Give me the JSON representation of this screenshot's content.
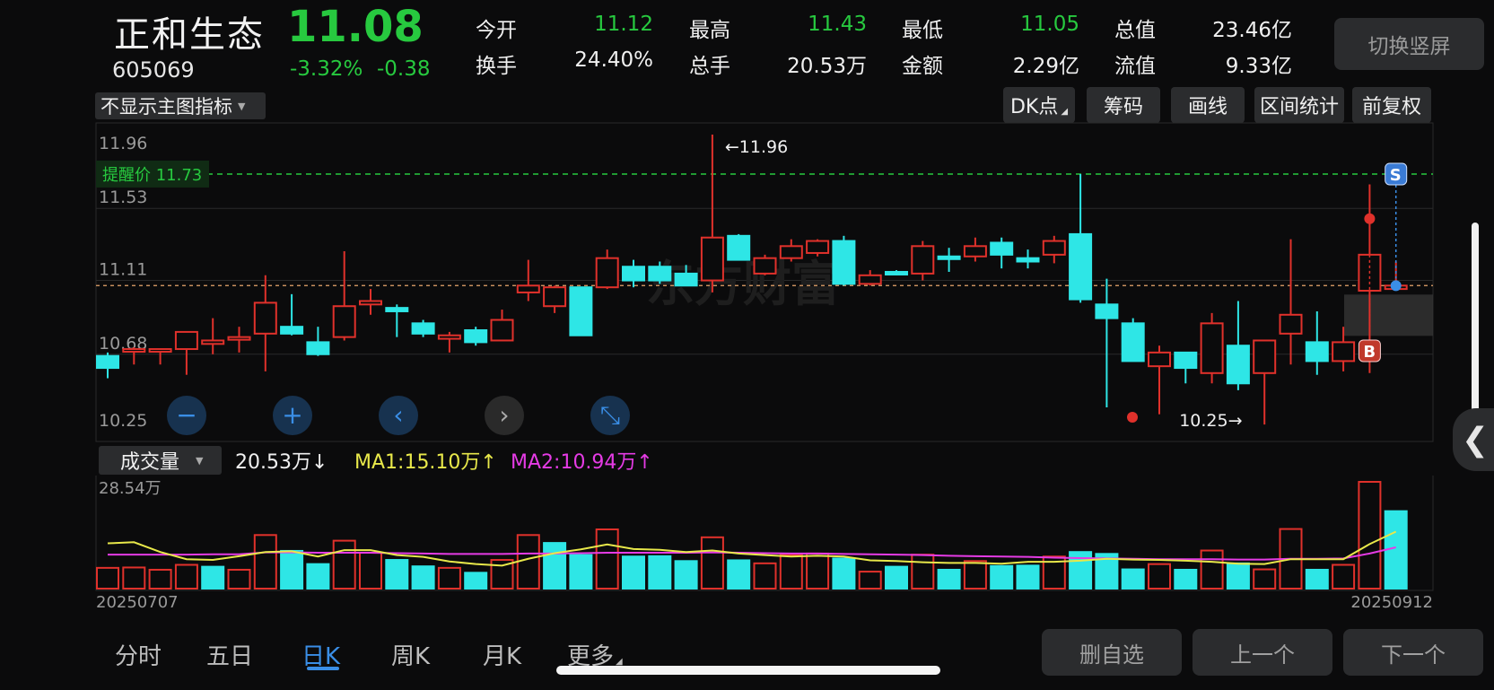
{
  "stock": {
    "name": "正和生态",
    "code": "605069",
    "price": "11.08",
    "pct": "-3.32%",
    "change": "-0.38"
  },
  "stats": [
    {
      "label": "今开",
      "value": "11.12",
      "color": "#27c93f"
    },
    {
      "label": "换手",
      "value": "24.40%",
      "color": "#f0f0f0"
    },
    {
      "label": "最高",
      "value": "11.43",
      "color": "#27c93f"
    },
    {
      "label": "总手",
      "value": "20.53万",
      "color": "#f0f0f0"
    },
    {
      "label": "最低",
      "value": "11.05",
      "color": "#27c93f"
    },
    {
      "label": "金额",
      "value": "2.29亿",
      "color": "#f0f0f0"
    },
    {
      "label": "总值",
      "value": "23.46亿",
      "color": "#f0f0f0"
    },
    {
      "label": "流值",
      "value": "9.33亿",
      "color": "#f0f0f0"
    }
  ],
  "switch_label": "切换竖屏",
  "indicator_select": "不显示主图指标",
  "toolbar": [
    "DK点",
    "筹码",
    "画线",
    "区间统计",
    "前复权"
  ],
  "chart": {
    "y_labels": [
      "11.96",
      "11.53",
      "11.11",
      "10.68",
      "10.25"
    ],
    "alert": "提醒价 11.73",
    "alert_price": 11.73,
    "reference_price": 11.08,
    "high_marker": "←11.96",
    "low_marker": "10.25→",
    "buy_marker": "B",
    "sell_marker": "S",
    "watermark": "东方财富",
    "up_color": "#e0312b",
    "down_color": "#2ee6e6",
    "alert_color": "#27c93f"
  },
  "chart_data": {
    "type": "candlestick",
    "ylim": [
      10.25,
      11.96
    ],
    "candles": [
      {
        "o": 10.67,
        "h": 10.69,
        "l": 10.54,
        "c": 10.6
      },
      {
        "o": 10.7,
        "h": 10.72,
        "l": 10.62,
        "c": 10.71
      },
      {
        "o": 10.71,
        "h": 10.71,
        "l": 10.62,
        "c": 10.71
      },
      {
        "o": 10.71,
        "h": 10.81,
        "l": 10.56,
        "c": 10.81
      },
      {
        "o": 10.74,
        "h": 10.89,
        "l": 10.68,
        "c": 10.76
      },
      {
        "o": 10.77,
        "h": 10.84,
        "l": 10.69,
        "c": 10.78
      },
      {
        "o": 10.8,
        "h": 11.14,
        "l": 10.58,
        "c": 10.98
      },
      {
        "o": 10.84,
        "h": 11.03,
        "l": 10.79,
        "c": 10.8
      },
      {
        "o": 10.75,
        "h": 10.84,
        "l": 10.67,
        "c": 10.68
      },
      {
        "o": 10.78,
        "h": 11.28,
        "l": 10.76,
        "c": 10.96
      },
      {
        "o": 10.97,
        "h": 11.06,
        "l": 10.91,
        "c": 10.99
      },
      {
        "o": 10.95,
        "h": 10.97,
        "l": 10.78,
        "c": 10.93
      },
      {
        "o": 10.86,
        "h": 10.88,
        "l": 10.78,
        "c": 10.8
      },
      {
        "o": 10.77,
        "h": 10.81,
        "l": 10.69,
        "c": 10.79
      },
      {
        "o": 10.82,
        "h": 10.84,
        "l": 10.73,
        "c": 10.75
      },
      {
        "o": 10.76,
        "h": 10.94,
        "l": 10.76,
        "c": 10.88
      },
      {
        "o": 11.04,
        "h": 11.23,
        "l": 10.99,
        "c": 11.08
      },
      {
        "o": 10.96,
        "h": 11.08,
        "l": 10.92,
        "c": 11.07
      },
      {
        "o": 11.07,
        "h": 11.07,
        "l": 10.79,
        "c": 10.79
      },
      {
        "o": 11.07,
        "h": 11.29,
        "l": 11.06,
        "c": 11.24
      },
      {
        "o": 11.19,
        "h": 11.23,
        "l": 11.07,
        "c": 11.11
      },
      {
        "o": 11.19,
        "h": 11.22,
        "l": 11.09,
        "c": 11.11
      },
      {
        "o": 11.15,
        "h": 11.2,
        "l": 11.08,
        "c": 11.08
      },
      {
        "o": 11.11,
        "h": 11.96,
        "l": 11.04,
        "c": 11.36
      },
      {
        "o": 11.37,
        "h": 11.38,
        "l": 11.24,
        "c": 11.23
      },
      {
        "o": 11.15,
        "h": 11.26,
        "l": 11.14,
        "c": 11.24
      },
      {
        "o": 11.24,
        "h": 11.35,
        "l": 11.22,
        "c": 11.31
      },
      {
        "o": 11.27,
        "h": 11.35,
        "l": 11.25,
        "c": 11.34
      },
      {
        "o": 11.34,
        "h": 11.37,
        "l": 11.08,
        "c": 11.09
      },
      {
        "o": 11.09,
        "h": 11.17,
        "l": 11.08,
        "c": 11.14
      },
      {
        "o": 11.16,
        "h": 11.17,
        "l": 11.14,
        "c": 11.15
      },
      {
        "o": 11.15,
        "h": 11.34,
        "l": 11.11,
        "c": 11.31
      },
      {
        "o": 11.25,
        "h": 11.3,
        "l": 11.16,
        "c": 11.24
      },
      {
        "o": 11.25,
        "h": 11.36,
        "l": 11.22,
        "c": 11.31
      },
      {
        "o": 11.33,
        "h": 11.36,
        "l": 11.18,
        "c": 11.26
      },
      {
        "o": 11.24,
        "h": 11.29,
        "l": 11.18,
        "c": 11.22
      },
      {
        "o": 11.26,
        "h": 11.37,
        "l": 11.21,
        "c": 11.34
      },
      {
        "o": 11.38,
        "h": 11.73,
        "l": 10.98,
        "c": 11.0
      },
      {
        "o": 10.97,
        "h": 11.12,
        "l": 10.37,
        "c": 10.89
      },
      {
        "o": 10.86,
        "h": 10.89,
        "l": 10.64,
        "c": 10.64
      },
      {
        "o": 10.61,
        "h": 10.73,
        "l": 10.33,
        "c": 10.69
      },
      {
        "o": 10.69,
        "h": 10.69,
        "l": 10.51,
        "c": 10.6
      },
      {
        "o": 10.57,
        "h": 10.92,
        "l": 10.51,
        "c": 10.86
      },
      {
        "o": 10.73,
        "h": 10.99,
        "l": 10.47,
        "c": 10.51
      },
      {
        "o": 10.57,
        "h": 10.67,
        "l": 10.27,
        "c": 10.76
      },
      {
        "o": 10.8,
        "h": 11.35,
        "l": 10.62,
        "c": 10.91
      },
      {
        "o": 10.75,
        "h": 10.93,
        "l": 10.56,
        "c": 10.64
      },
      {
        "o": 10.64,
        "h": 10.84,
        "l": 10.58,
        "c": 10.75
      },
      {
        "o": 11.05,
        "h": 11.67,
        "l": 10.57,
        "c": 11.26
      },
      {
        "o": 11.06,
        "h": 11.22,
        "l": 11.05,
        "c": 11.08
      }
    ]
  },
  "volume": {
    "selector": "成交量",
    "current": "20.53万↓",
    "ma1": "MA1:15.10万↑",
    "ma2": "MA2:10.94万↑",
    "ma1_color": "#e8e84a",
    "ma2_color": "#e53be5",
    "y_max_label": "28.54万",
    "y_min_label": "0",
    "ylim": [
      0,
      28.54
    ],
    "start_date": "20250707",
    "end_date": "20250912",
    "values": [
      5.5,
      5.6,
      5.0,
      6.3,
      5.8,
      5.0,
      14.2,
      10.0,
      6.5,
      12.7,
      9.5,
      7.6,
      5.9,
      5.5,
      4.2,
      7.6,
      14.2,
      12.1,
      8.9,
      15.7,
      8.5,
      8.6,
      7.3,
      13.6,
      7.5,
      6.7,
      8.9,
      9.3,
      8.0,
      4.5,
      5.8,
      9.0,
      5.0,
      7.3,
      6.0,
      6.1,
      8.5,
      9.7,
      9.2,
      5.1,
      6.5,
      5.0,
      10.1,
      6.7,
      5.1,
      15.8,
      5.0,
      6.3,
      28.3,
      20.53
    ],
    "ma1_values": [
      12.0,
      12.3,
      9.7,
      7.8,
      7.6,
      8.6,
      9.7,
      9.9,
      8.5,
      10.2,
      10.2,
      8.9,
      8.4,
      7.2,
      6.5,
      6.1,
      7.9,
      9.4,
      10.4,
      11.7,
      10.5,
      10.3,
      9.7,
      10.1,
      9.3,
      8.9,
      8.5,
      8.7,
      8.5,
      7.5,
      7.3,
      7.0,
      6.8,
      6.8,
      6.6,
      7.1,
      7.1,
      7.4,
      7.9,
      7.7,
      7.6,
      7.4,
      7.1,
      6.6,
      6.5,
      7.8,
      7.8,
      7.8,
      11.8,
      15.1
    ],
    "ma2_values": [
      9.0,
      9.0,
      9.0,
      9.0,
      9.1,
      9.1,
      9.6,
      9.6,
      9.5,
      9.5,
      9.5,
      9.4,
      9.3,
      9.2,
      9.2,
      9.2,
      9.3,
      9.3,
      9.4,
      9.5,
      9.5,
      9.5,
      9.5,
      9.6,
      9.5,
      9.4,
      9.3,
      9.3,
      9.2,
      9.1,
      9.0,
      8.9,
      8.7,
      8.6,
      8.5,
      8.4,
      8.2,
      8.1,
      8.0,
      7.9,
      7.8,
      7.8,
      7.8,
      7.7,
      7.7,
      7.9,
      7.9,
      8.0,
      9.3,
      10.94
    ],
    "vol_up": [
      true,
      true,
      true,
      true,
      false,
      true,
      true,
      false,
      false,
      true,
      true,
      false,
      false,
      true,
      false,
      true,
      true,
      false,
      false,
      true,
      false,
      false,
      false,
      true,
      false,
      true,
      true,
      true,
      false,
      true,
      false,
      true,
      false,
      true,
      false,
      false,
      true,
      false,
      false,
      false,
      true,
      false,
      true,
      false,
      true,
      true,
      false,
      true,
      true,
      false
    ]
  },
  "nav_tabs": [
    "分时",
    "五日",
    "日K",
    "周K",
    "月K",
    "更多"
  ],
  "active_tab": "日K",
  "bottom_buttons": [
    "删自选",
    "上一个",
    "下一个"
  ]
}
